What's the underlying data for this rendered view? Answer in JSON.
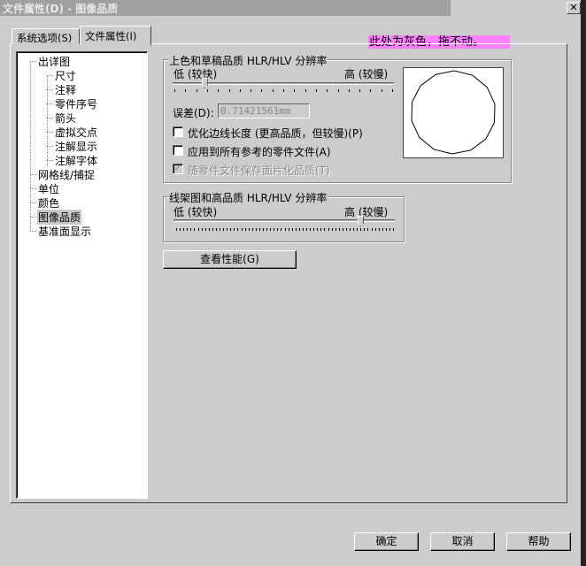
{
  "window": {
    "title": "文件属性(D) - 图像品质",
    "close": "✕"
  },
  "tabs": [
    {
      "label": "系统选项(S)"
    },
    {
      "label": "文件属性(I)"
    }
  ],
  "note": "此处为灰色，拖不动。",
  "tree": [
    {
      "label": "出详图"
    },
    {
      "label": "尺寸"
    },
    {
      "label": "注释"
    },
    {
      "label": "零件序号"
    },
    {
      "label": "箭头"
    },
    {
      "label": "虚拟交点"
    },
    {
      "label": "注解显示"
    },
    {
      "label": "注解字体"
    },
    {
      "label": "网格线/捕捉"
    },
    {
      "label": "单位"
    },
    {
      "label": "颜色"
    },
    {
      "label": "图像品质"
    },
    {
      "label": "基准面显示"
    }
  ],
  "shaded": {
    "title": "上色和草稿品质 HLR/HLV 分辨率",
    "low": "低 (较快)",
    "high": "高 (较慢)",
    "slider_value_fraction": 0.14,
    "error_label": "误差(D):",
    "error_value": "0.71421561mm",
    "checkboxes": [
      {
        "label": "优化边线长度 (更高品质，但较慢)(P)",
        "checked": false,
        "disabled": false
      },
      {
        "label": "应用到所有参考的零件文件(A)",
        "checked": false,
        "disabled": false
      },
      {
        "label": "随零件文件保存面片化品质(T)",
        "checked": true,
        "disabled": true
      }
    ]
  },
  "wireframe": {
    "title": "线架图和高品质 HLR/HLV 分辨率",
    "low": "低 (较快)",
    "high": "高 (较慢)",
    "slider_value_fraction": 0.87
  },
  "perf_button": "查看性能(G)",
  "footer": {
    "ok": "确定",
    "cancel": "取消",
    "help": "帮助"
  }
}
